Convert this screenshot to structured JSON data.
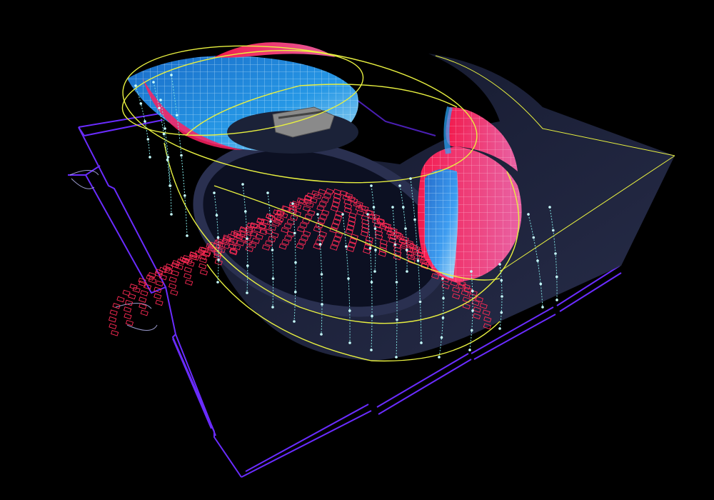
{
  "viewport": {
    "background": "#000000"
  },
  "colors": {
    "floor_plan": "#6a2cff",
    "floor_plan_bright": "#8a4bff",
    "shell_fill": "#2a2f4a",
    "curve": "#e8f040",
    "spine": "#7fe0e0",
    "mesh_blue": "#2aa8ff",
    "mesh_red": "#ff2060",
    "mesh_pink": "#ff4fa0",
    "seats": "#ff2a55",
    "stage_object": "#8a8a8a"
  },
  "icons": {
    "floor_plan": "floor-plan-outline",
    "seating": "seating-grid",
    "stage": "stage-object"
  }
}
